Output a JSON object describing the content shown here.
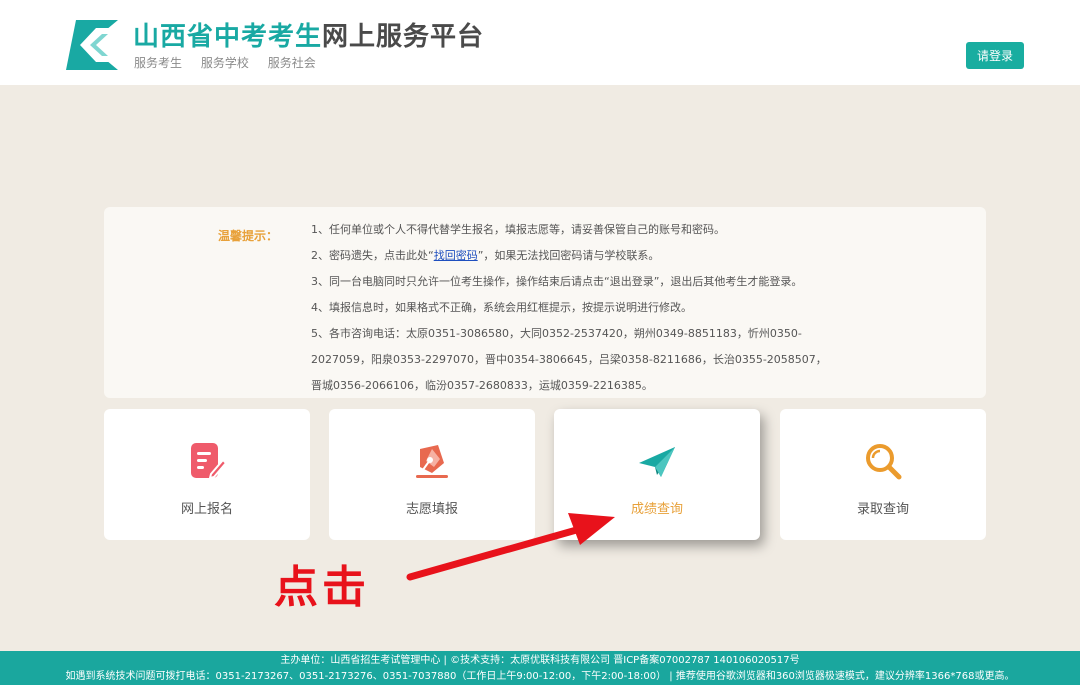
{
  "header": {
    "title_part1": "山西省中考考生",
    "title_part2": "网上服务平台",
    "slogans": [
      "服务考生",
      "服务学校",
      "服务社会"
    ],
    "login_label": "请登录"
  },
  "notice": {
    "label": "温馨提示：",
    "item1": "1、任何单位或个人不得代替学生报名，填报志愿等，请妥善保管自己的账号和密码。",
    "item2_before": "2、密码遗失，点击此处“",
    "item2_link": "找回密码",
    "item2_after": "”，如果无法找回密码请与学校联系。",
    "item3": "3、同一台电脑同时只允许一位考生操作，操作结束后请点击“退出登录”，退出后其他考生才能登录。",
    "item4": "4、填报信息时，如果格式不正确，系统会用红框提示，按提示说明进行修改。",
    "item5": "5、各市咨询电话：太原0351-3086580，大同0352-2537420，朔州0349-8851183，忻州0350-2027059，阳泉0353-2297070，晋中0354-3806645，吕梁0358-8211686，长治0355-2058507，晋城0356-2066106，临汾0357-2680833，运城0359-2216385。"
  },
  "cards": [
    {
      "label": "网上报名",
      "icon": "edit-document-icon",
      "color": "#ef5b6b"
    },
    {
      "label": "志愿填报",
      "icon": "pen-nib-icon",
      "color": "#e8694f"
    },
    {
      "label": "成绩查询",
      "icon": "paper-plane-icon",
      "color": "#19a9a3"
    },
    {
      "label": "录取查询",
      "icon": "magnifier-icon",
      "color": "#eb9b2d"
    }
  ],
  "annotation": {
    "text": "点击",
    "color": "#e8121b"
  },
  "footer": {
    "line1": "主办单位：山西省招生考试管理中心   |   ©技术支持：太原优联科技有限公司   晋ICP备案07002787    140106020517号",
    "line2": "如遇到系统技术问题可拨打电话：0351-2173267、0351-2173276、0351-7037880（工作日上午9:00-12:00，下午2:00-18:00）   |   推荐使用谷歌浏览器和360浏览器极速模式，建议分辨率1366*768或更高。"
  },
  "colors": {
    "brand": "#19a9a3",
    "background": "#f0ebe3",
    "accent": "#e8a13a"
  }
}
